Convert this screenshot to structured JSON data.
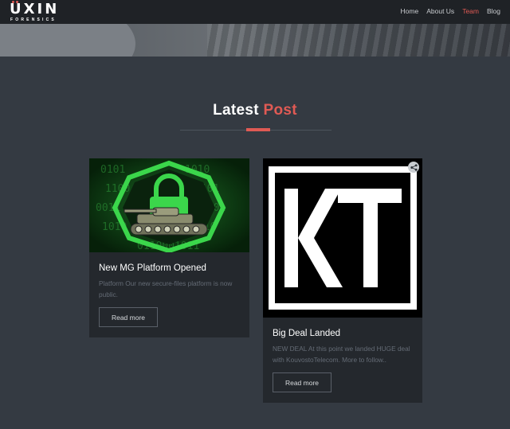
{
  "header": {
    "logo_main": "UXIN",
    "logo_sub": "FORENSICS",
    "nav": [
      "Home",
      "About Us",
      "Team",
      "Blog"
    ],
    "active": "Team",
    "colors": {
      "accent": "#e05a54",
      "bar": "#1f2226"
    }
  },
  "section": {
    "title_part1": "Latest",
    "title_part2": "Post"
  },
  "posts": [
    {
      "title": "New MG Platform Opened",
      "excerpt": "Platform Our new secure-files platform is now public.",
      "button": "Read more",
      "image_icon": "lock-tank-icon"
    },
    {
      "title": "Big Deal Landed",
      "excerpt": "NEW DEAL At this point we landed HUGE deal with KouvostoTelecom. More to follow..",
      "button": "Read more",
      "image_icon": "kt-logo"
    }
  ]
}
